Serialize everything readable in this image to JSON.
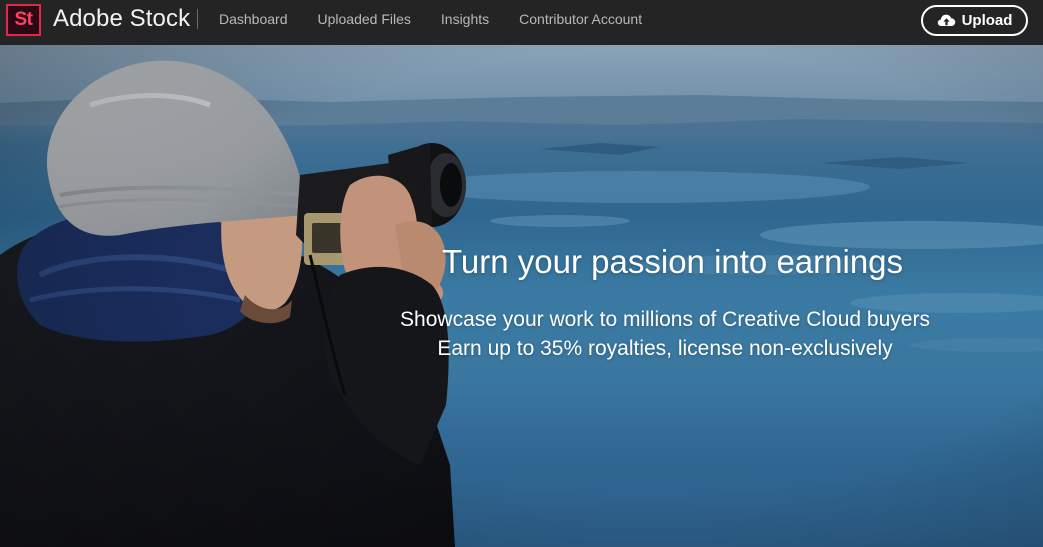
{
  "navbar": {
    "logo_text": "St",
    "brand": "Adobe Stock",
    "links": [
      "Dashboard",
      "Uploaded Files",
      "Insights",
      "Contributor Account"
    ],
    "upload_label": "Upload"
  },
  "hero": {
    "headline": "Turn your passion into earnings",
    "subline_1": "Showcase your work to millions of Creative Cloud buyers",
    "subline_2": "Earn up to 35% royalties, license non-exclusively"
  },
  "colors": {
    "nav_bg": "#242424",
    "logo_accent": "#ff3e69",
    "hero_water": "#3b7ba3"
  },
  "icons": {
    "upload": "cloud-upload-icon",
    "logo": "adobe-stock-logo-icon"
  }
}
